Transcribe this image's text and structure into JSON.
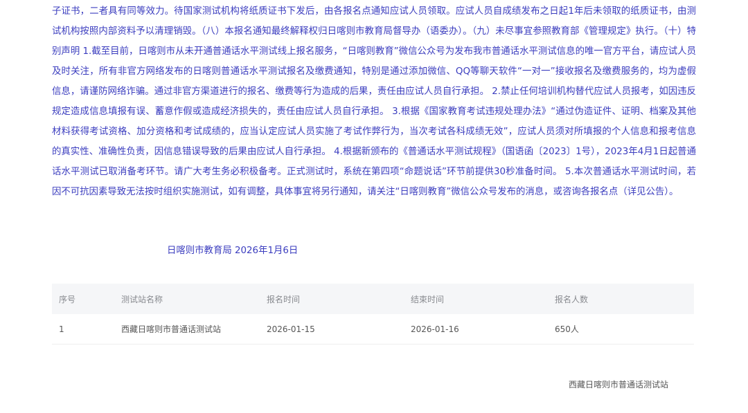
{
  "notice": {
    "body": "子证书，二者具有同等效力。待国家测试机构将纸质证书下发后，由各报名点通知应试人员领取。应试人员自成绩发布之日起1年后未领取的纸质证书，由测试机构按照内部资料予以清理销毁。（八）本报名通知最终解释权归日喀则市教育局督导办（语委办）。（九）未尽事宜参照教育部《管理规定》执行。（十）特别声明 1.截至目前，日喀则市从未开通普通话水平测试线上报名服务，“日喀则教育”微信公众号为发布我市普通话水平测试信息的唯一官方平台，请应试人员及时关注，所有非官方网络发布的日喀则普通话水平测试报名及缴费通知，特别是通过添加微信、QQ等聊天软件“一对一”接收报名及缴费服务的，均为虚假信息，请谨防网络诈骗。通过非官方渠道进行的报名、缴费等行为造成的后果，责任由应试人员自行承担。 2.禁止任何培训机构替代应试人员报考，如因违反规定造成信息填报有误、蓄意作假或造成经济损失的，责任由应试人员自行承担。 3.根据《国家教育考试违规处理办法》“通过伪造证件、证明、档案及其他材料获得考试资格、加分资格和考试成绩的，应当认定应试人员实施了考试作弊行为，当次考试各科成绩无效”，应试人员须对所填报的个人信息和报考信息的真实性、准确性负责，因信息错误导致的后果由应试人自行承担。 4.根据新颁布的《普通话水平测试规程》（国语函〔2023〕1号），2023年4月1日起普通话水平测试已取消备考环节。请广大考生务必积极备考。正式测试时，系统在第四项“命题说话”环节前提供30秒准备时间。 5.本次普通话水平测试时间，若因不可抗因素导致无法按时组织实施测试，如有调整，具体事宜将另行通知，请关注“日喀则教育”微信公众号发布的消息，或咨询各报名点（详见公告）。",
    "signature_org": "日喀则市教育局",
    "signature_date": "2026年1月6日"
  },
  "table": {
    "headers": [
      "序号",
      "测试站名称",
      "报名时间",
      "结束时间",
      "报名人数"
    ],
    "rows": [
      [
        "1",
        "西藏日喀则市普通话测试站",
        "2026-01-15",
        "2026-01-16",
        "650人"
      ]
    ]
  },
  "footer": {
    "org": "西藏日喀则市普通话测试站"
  },
  "colors": {
    "notice_text": "#3b3dbf",
    "table_header_bg": "#f5f6f8",
    "table_header_text": "#888a8f",
    "table_cell_text": "#555555"
  }
}
